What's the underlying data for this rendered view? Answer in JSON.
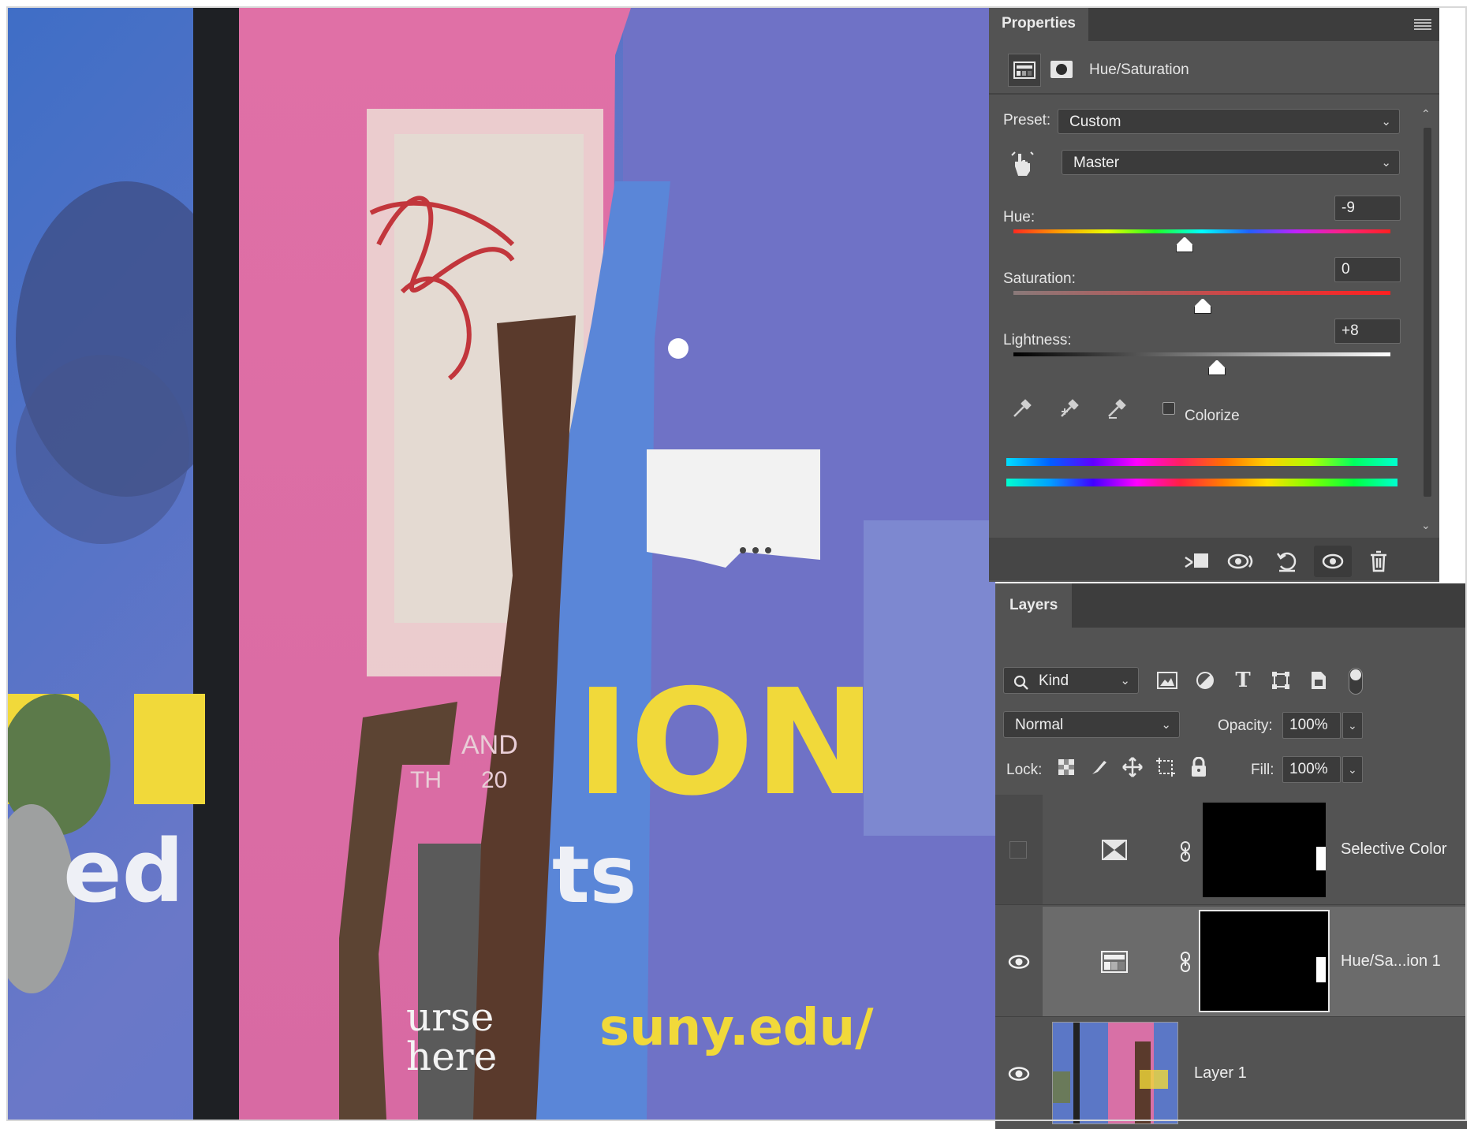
{
  "properties": {
    "tab_label": "Properties",
    "adjustment_title": "Hue/Saturation",
    "preset_label": "Preset:",
    "preset_value": "Custom",
    "channel_value": "Master",
    "hue_label": "Hue:",
    "hue_value": "-9",
    "saturation_label": "Saturation:",
    "saturation_value": "0",
    "lightness_label": "Lightness:",
    "lightness_value": "+8",
    "colorize_label": "Colorize",
    "colorize_checked": false
  },
  "layers": {
    "tab_label": "Layers",
    "filter_value": "Kind",
    "blend_mode": "Normal",
    "opacity_label": "Opacity:",
    "opacity_value": "100%",
    "lock_label": "Lock:",
    "fill_label": "Fill:",
    "fill_value": "100%",
    "items": [
      {
        "name": "Selective Color",
        "visible": false,
        "selected": false
      },
      {
        "name": "Hue/Sa...ion 1",
        "visible": true,
        "selected": true
      },
      {
        "name": "Layer 1",
        "visible": true,
        "selected": false
      }
    ]
  },
  "canvas": {
    "poster_texts": [
      "ION",
      "ed",
      "ts",
      "suny.edu/",
      "urse",
      "here",
      "AND",
      "TH",
      "20"
    ]
  },
  "colors": {
    "panel_bg": "#535353",
    "panel_dark": "#3d3d3d",
    "field_bg": "#3b3b3b",
    "selected_row": "#6b6b6b",
    "text": "#e6e6e6"
  }
}
